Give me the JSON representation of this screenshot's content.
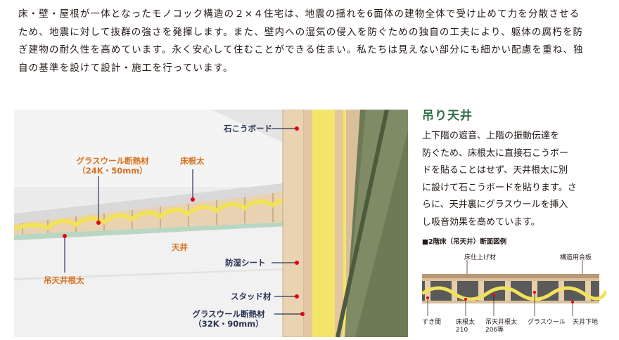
{
  "intro_lines": [
    "床・壁・屋根が一体となったモノコック構造の２×４住宅は、地震の揺れを6面体の建物全体で受け止めて力を分散させる",
    "ため、地震に対して抜群の強さを発揮します。また、壁内への湿気の侵入を防ぐための独自の工夫により、躯体の腐朽を防",
    "ぎ建物の耐久性を高めています。永く安心して住むことができる住まい。私たちは見えない部分にも細かい配慮を重ね、独",
    "自の基準を設けて設計・施工を行っています。"
  ],
  "illustration_labels": {
    "gypsum_board": "石こうボード",
    "glass_wool_floor": "グラスウール断熱材",
    "glass_wool_floor_spec": "（24K・50mm）",
    "floor_joist": "床根太",
    "ceiling": "天井",
    "ceiling_joist": "吊天井根太",
    "vapor_sheet": "防湿シート",
    "stud": "スタッド材",
    "glass_wool_wall": "グラスウール断熱材",
    "glass_wool_wall_spec": "（32K・90mm）"
  },
  "colors": {
    "orange_label": "#d9711e",
    "navy_label": "#2b3457",
    "heading_green": "#2f6d45",
    "wood": "#e6ccab",
    "wool_yellow": "#f1e25a",
    "wall_gray": "#f0f0f0",
    "outer_green": "#6e7a55"
  },
  "section": {
    "title": "吊り天井",
    "body_lines": [
      "上下階の遮音、上階の振動伝達を",
      "防ぐため、床根太に直接石こうボー",
      "ドを貼ることはせず、天井根太に別",
      "に設けて石こうボードを貼ります。さ",
      "らに、天井裏にグラスウールを挿入",
      "し吸音効果を高めています。"
    ]
  },
  "diagram": {
    "caption": "■2階床（吊天井）断面図例",
    "labels": {
      "floor_finish": "床仕上げ材",
      "structural_plywood": "構造用合板",
      "gap": "すき間",
      "floor_joist": "床根太",
      "floor_joist_size": "210",
      "ceiling_joist": "吊天井根太",
      "ceiling_joist_size": "206等",
      "glass_wool": "グラスウール",
      "ceiling_base": "天井下地"
    }
  }
}
